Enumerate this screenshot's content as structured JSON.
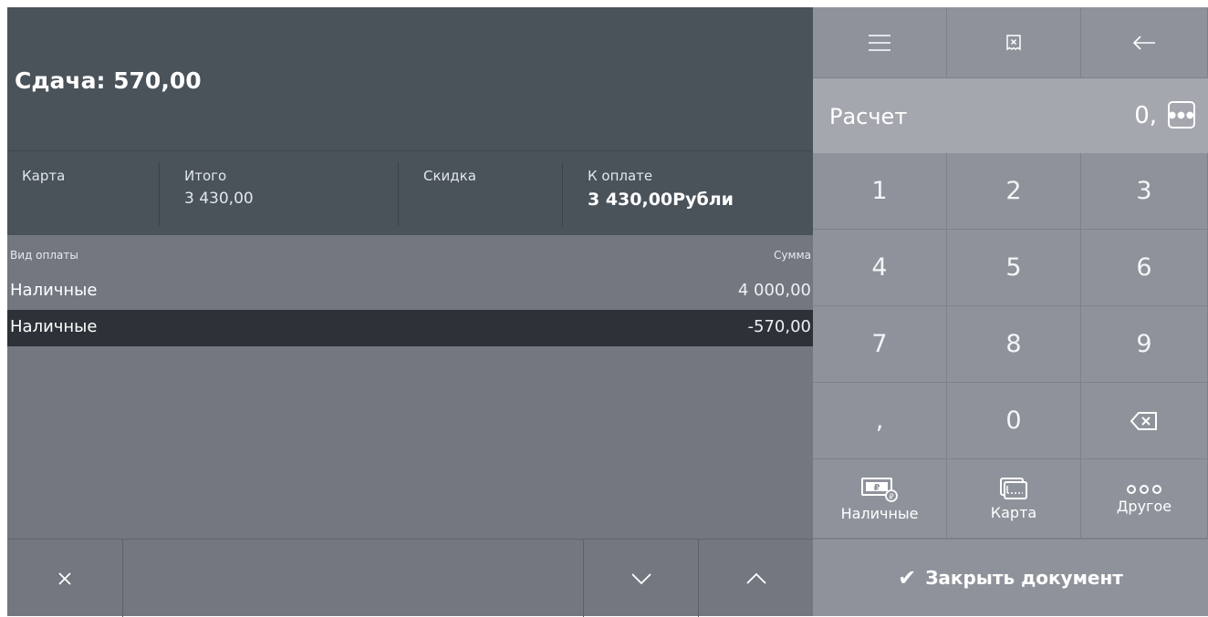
{
  "header": {
    "change_text": "Сдача: 570,00"
  },
  "summary": {
    "payment_type_label": "Карта",
    "total_label": "Итого",
    "total_value": "3 430,00",
    "discount_label": "Скидка",
    "to_pay_label": "К оплате",
    "to_pay_value": "3 430,00Рубли"
  },
  "payments": {
    "col_type": "Вид оплаты",
    "col_amount": "Сумма",
    "rows": [
      {
        "type": "Наличные",
        "amount": "4 000,00"
      },
      {
        "type": "Наличные",
        "amount": "-570,00"
      }
    ]
  },
  "bottom_toolbar": {
    "clear_icon": "close-icon",
    "down_icon": "chevron-down-icon",
    "up_icon": "chevron-up-icon"
  },
  "top_toolbar": {
    "menu_icon": "menu-icon",
    "cancel_receipt_icon": "receipt-cancel-icon",
    "back_icon": "arrow-left-icon"
  },
  "calc": {
    "label": "Расчет",
    "value": "0,"
  },
  "keypad": {
    "keys": [
      "1",
      "2",
      "3",
      "4",
      "5",
      "6",
      "7",
      "8",
      "9",
      ",",
      "0"
    ],
    "backspace_icon": "backspace-icon"
  },
  "payment_methods": {
    "cash": "Наличные",
    "card": "Карта",
    "other": "Другое"
  },
  "close_document": "Закрыть документ"
}
